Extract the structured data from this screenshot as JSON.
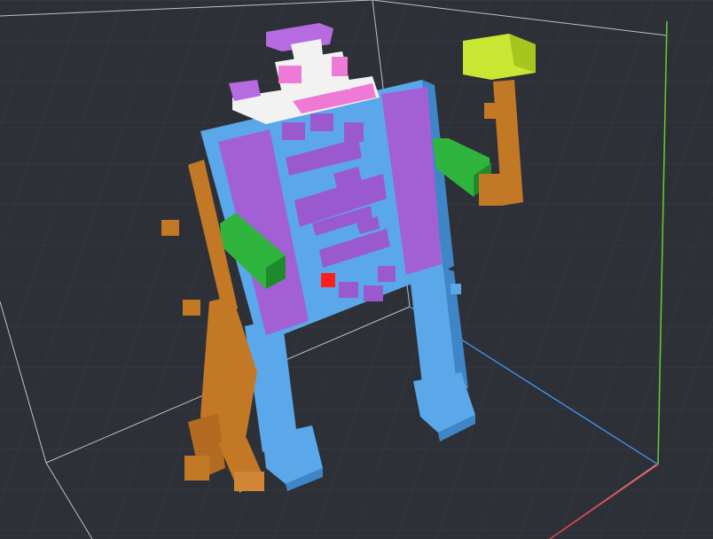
{
  "viewport": {
    "kind": "voxel-editor-3d-viewport",
    "background_color": "#2e3038",
    "floor_color": "#24252d",
    "grid_line_color": "#3c3e49",
    "bounding_box_color": "#d8d8e0"
  },
  "axes": {
    "x_color": "#e04646",
    "y_color": "#66cc33",
    "z_color": "#3da0ff"
  },
  "model": {
    "name": "voxel-robot",
    "colors": {
      "body_blue": "#5aa8ea",
      "panel_purple": "#a35fd4",
      "detail_purple": "#9b59d0",
      "arm_green": "#2fb43d",
      "staff_brown": "#c37826",
      "hammer_yellow": "#c8e632",
      "hat_white": "#f2f2f2",
      "hat_pink": "#ef7ad6",
      "hat_purple": "#b66be0",
      "indicator_red": "#ff1e1e"
    }
  }
}
